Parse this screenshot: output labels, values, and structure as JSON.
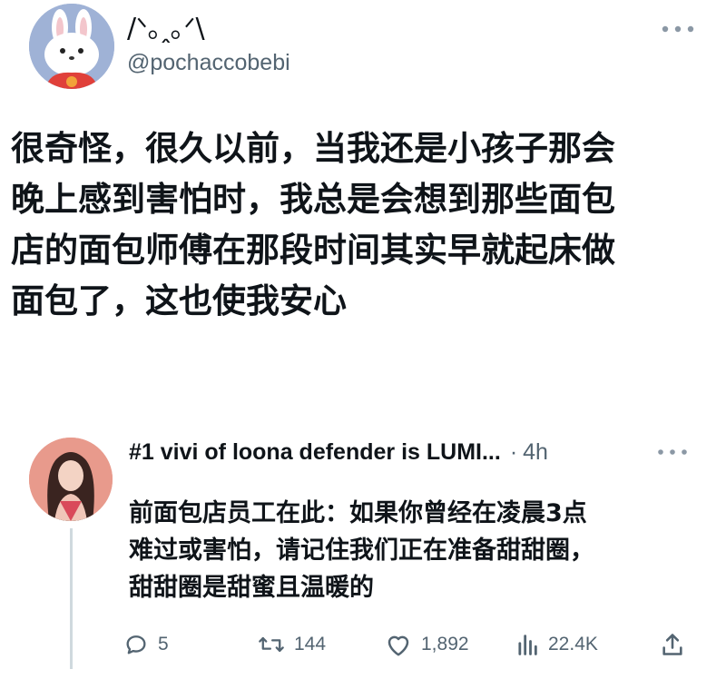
{
  "tweet": {
    "author": {
      "display_name": "/ᐠ｡ꞈ｡ᐟ\\",
      "handle": "@pochaccobebi",
      "avatar": "bunny-avatar"
    },
    "text_lines": [
      "很奇怪，很久以前，当我还是小孩子那会",
      "晚上感到害怕时，我总是会想到那些面包",
      "店的面包师傅在那段时间其实早就起床做",
      "面包了，这也使我安心"
    ]
  },
  "reply": {
    "author": {
      "display_name": "#1 vivi of loona defender is LUMI...",
      "time": "4h",
      "separator": "·",
      "avatar": "girl-avatar"
    },
    "text_lines": [
      "前面包店员工在此：如果你曾经在凌晨3点",
      "难过或害怕，请记住我们正在准备甜甜圈，",
      "甜甜圈是甜蜜且温暖的"
    ],
    "actions": {
      "reply_count": "5",
      "retweet_count": "144",
      "like_count": "1,892",
      "view_count": "22.4K"
    }
  },
  "colors": {
    "text_primary": "#0f1419",
    "text_secondary": "#536471",
    "thread_line": "#cfd9de",
    "main_avatar_bg": "#9fb2d6",
    "reply_avatar_bg": "#e89a8c"
  },
  "icons": [
    "more-icon",
    "reply-icon",
    "retweet-icon",
    "like-icon",
    "views-icon",
    "share-icon"
  ]
}
